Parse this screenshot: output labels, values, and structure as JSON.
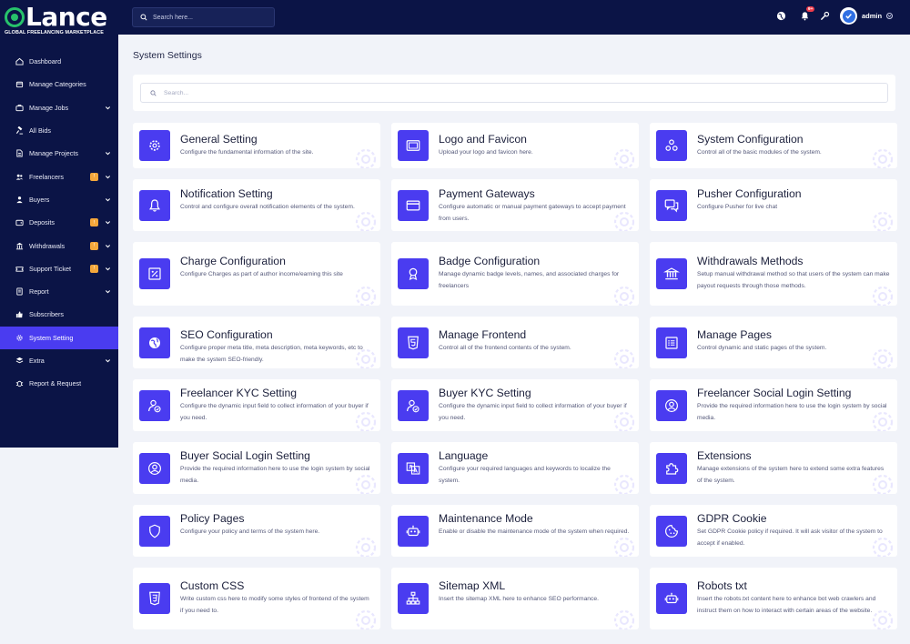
{
  "brand": {
    "name": "Lance",
    "tagline": "GLOBAL FREELANCING MARKETPLACE"
  },
  "header": {
    "search_placeholder": "Search here...",
    "notification_count": "9+",
    "user_name": "admin"
  },
  "sidebar": {
    "items": [
      {
        "label": "Dashboard",
        "icon": "home-icon",
        "chevron": false,
        "badge": false,
        "active": false
      },
      {
        "label": "Manage Categories",
        "icon": "box-icon",
        "chevron": false,
        "badge": false,
        "active": false
      },
      {
        "label": "Manage Jobs",
        "icon": "briefcase-icon",
        "chevron": true,
        "badge": false,
        "active": false
      },
      {
        "label": "All Bids",
        "icon": "gavel-icon",
        "chevron": false,
        "badge": false,
        "active": false
      },
      {
        "label": "Manage Projects",
        "icon": "file-icon",
        "chevron": true,
        "badge": false,
        "active": false
      },
      {
        "label": "Freelancers",
        "icon": "users-icon",
        "chevron": true,
        "badge": true,
        "active": false
      },
      {
        "label": "Buyers",
        "icon": "user-group-icon",
        "chevron": true,
        "badge": false,
        "active": false
      },
      {
        "label": "Deposits",
        "icon": "wallet-icon",
        "chevron": true,
        "badge": true,
        "active": false
      },
      {
        "label": "Withdrawals",
        "icon": "bank-icon",
        "chevron": true,
        "badge": true,
        "active": false
      },
      {
        "label": "Support Ticket",
        "icon": "ticket-icon",
        "chevron": true,
        "badge": true,
        "active": false
      },
      {
        "label": "Report",
        "icon": "report-icon",
        "chevron": true,
        "badge": false,
        "active": false
      },
      {
        "label": "Subscribers",
        "icon": "thumbs-up-icon",
        "chevron": false,
        "badge": false,
        "active": false
      },
      {
        "label": "System Setting",
        "icon": "gear-icon",
        "chevron": false,
        "badge": false,
        "active": true
      },
      {
        "label": "Extra",
        "icon": "layers-icon",
        "chevron": true,
        "badge": false,
        "active": false
      },
      {
        "label": "Report & Request",
        "icon": "bug-icon",
        "chevron": false,
        "badge": false,
        "active": false
      }
    ]
  },
  "main": {
    "title": "System Settings",
    "search_placeholder": "Search...",
    "cards": [
      {
        "title": "General Setting",
        "desc": "Configure the fundamental information of the site.",
        "icon": "gear-icon"
      },
      {
        "title": "Logo and Favicon",
        "desc": "Upload your logo and favicon here.",
        "icon": "image-icon"
      },
      {
        "title": "System Configuration",
        "desc": "Control all of the basic modules of the system.",
        "icon": "modules-icon"
      },
      {
        "title": "Notification Setting",
        "desc": "Control and configure overall notification elements of the system.",
        "icon": "bell-icon"
      },
      {
        "title": "Payment Gateways",
        "desc": "Configure automatic or manual payment gateways to accept payment from users.",
        "icon": "credit-card-icon"
      },
      {
        "title": "Pusher Configuration",
        "desc": "Configure Pusher for live chat",
        "icon": "chat-icon"
      },
      {
        "title": "Charge Configuration",
        "desc": "Configure Charges as part of author income/earning this site",
        "icon": "percent-icon"
      },
      {
        "title": "Badge Configuration",
        "desc": "Manage dynamic badge levels, names, and associated charges for freelancers",
        "icon": "award-icon"
      },
      {
        "title": "Withdrawals Methods",
        "desc": "Setup manual withdrawal method so that users of the system can make payout requests through those methods.",
        "icon": "bank-icon"
      },
      {
        "title": "SEO Configuration",
        "desc": "Configure proper meta title, meta description, meta keywords, etc to make the system SEO-friendly.",
        "icon": "globe-icon"
      },
      {
        "title": "Manage Frontend",
        "desc": "Control all of the frontend contents of the system.",
        "icon": "html5-icon"
      },
      {
        "title": "Manage Pages",
        "desc": "Control dynamic and static pages of the system.",
        "icon": "list-icon"
      },
      {
        "title": "Freelancer KYC Setting",
        "desc": "Configure the dynamic input field to collect information of your buyer if you need.",
        "icon": "user-check-icon"
      },
      {
        "title": "Buyer KYC Setting",
        "desc": "Configure the dynamic input field to collect information of your buyer if you need.",
        "icon": "user-check-icon"
      },
      {
        "title": "Freelancer Social Login Setting",
        "desc": "Provide the required information here to use the login system by social media.",
        "icon": "user-circle-icon"
      },
      {
        "title": "Buyer Social Login Setting",
        "desc": "Provide the required information here to use the login system by social media.",
        "icon": "user-circle-icon"
      },
      {
        "title": "Language",
        "desc": "Configure your required languages and keywords to localize the system.",
        "icon": "language-icon"
      },
      {
        "title": "Extensions",
        "desc": "Manage extensions of the system here to extend some extra features of the system.",
        "icon": "puzzle-icon"
      },
      {
        "title": "Policy Pages",
        "desc": "Configure your policy and terms of the system here.",
        "icon": "shield-icon"
      },
      {
        "title": "Maintenance Mode",
        "desc": "Enable or disable the maintenance mode of the system when required.",
        "icon": "robot-icon"
      },
      {
        "title": "GDPR Cookie",
        "desc": "Set GDPR Cookie policy if required. It will ask visitor of the system to accept if enabled.",
        "icon": "cookie-icon"
      },
      {
        "title": "Custom CSS",
        "desc": "Write custom css here to modify some styles of frontend of the system if you need to.",
        "icon": "css3-icon"
      },
      {
        "title": "Sitemap XML",
        "desc": "Insert the sitemap XML here to enhance SEO performance.",
        "icon": "sitemap-icon"
      },
      {
        "title": "Robots txt",
        "desc": "Insert the robots.txt content here to enhance bot web crawlers and instruct them on how to interact with certain areas of the website.",
        "icon": "robot-icon"
      }
    ]
  },
  "colors": {
    "sidebar_bg": "#0b1446",
    "accent": "#4a3cf0",
    "badge": "#f5a73b",
    "notification": "#ef3b4a",
    "page_bg": "#f1f3f9"
  }
}
